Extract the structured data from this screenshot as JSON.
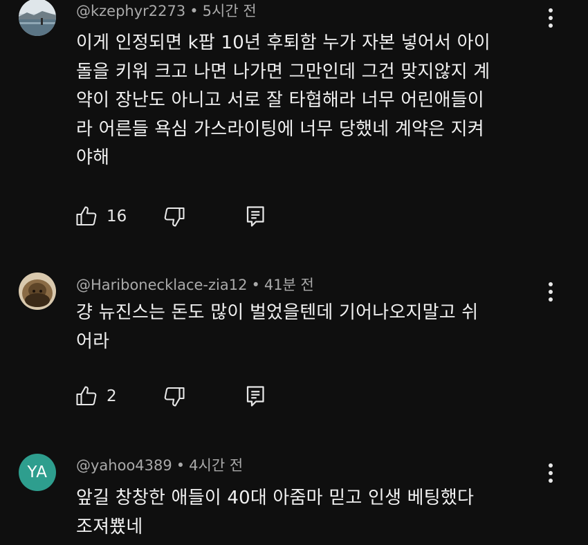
{
  "comments": [
    {
      "author": "@kzephyr2273",
      "separator": "•",
      "time": "5시간 전",
      "lines": [
        "이게 인정되면 k팝 10년 후퇴함 누가 자본 넣어서 아이",
        "돌을 키워 크고 나면 나가면 그만인데 그건 맞지않지 계",
        "약이 장난도 아니고 서로 잘 타협해라 너무 어린애들이",
        "라 어른들 욕심 가스라이팅에 너무 당했네 계약은 지켜",
        "야해"
      ],
      "likes": "16"
    },
    {
      "author": "@Haribonecklace-zia12",
      "separator": "•",
      "time": "41분 전",
      "lines": [
        "걍 뉴진스는 돈도 많이 벌었을텐데 기어나오지말고 쉬",
        "어라"
      ],
      "likes": "2"
    },
    {
      "author": "@yahoo4389",
      "separator": "•",
      "time": "4시간 전",
      "avatar_initials": "YA",
      "avatar_color": "#2e9e8e",
      "lines": [
        "앞길 창창한 애들이 40대 아줌마 믿고 인생 베팅했다",
        "조져뿄네"
      ]
    }
  ],
  "icons": {
    "like": "thumbs-up-icon",
    "dislike": "thumbs-down-icon",
    "reply": "reply-icon",
    "more": "more-vert-icon"
  }
}
